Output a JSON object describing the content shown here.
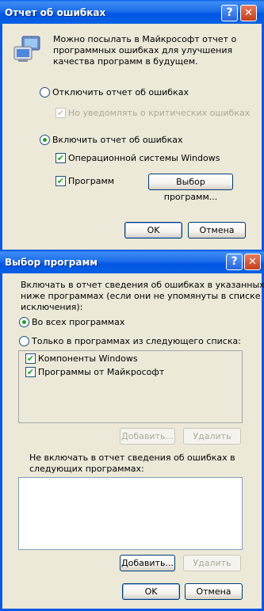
{
  "dialog1": {
    "title": "Отчет об ошибках",
    "description_lines": [
      "Можно посылать в Майкрософт отчет о",
      "программных ошибках для улучшения",
      "качества программ в будущем."
    ],
    "disable_option": "Отключить отчет об ошибках",
    "notify_critical": "Но уведомлять о критических ошибках",
    "enable_option": "Включить отчет об ошибках",
    "windows_os": "Операционной системы Windows",
    "programs": "Программ",
    "choose_programs_button": "Выбор программ...",
    "ok_button": "OK",
    "cancel_button": "Отмена"
  },
  "dialog2": {
    "title": "Выбор программ",
    "include_lines": [
      "Включать в отчет сведения об ошибках в указанных",
      "ниже программах (если они не упомянуты в списке",
      "исключения):"
    ],
    "all_programs": "Во всех программах",
    "only_listed": "Только в программах из следующего списка:",
    "list_items": [
      "Компоненты Windows",
      "Программы от Майкрософт"
    ],
    "add_button": "Добавить...",
    "remove_button": "Удалить",
    "exclude_lines": [
      "Не включать в отчет сведения об ошибках в",
      "следующих программах:"
    ],
    "add_button2": "Добавить...",
    "remove_button2": "Удалить",
    "ok_button": "OK",
    "cancel_button": "Отмена"
  },
  "titlebar_buttons": {
    "help": "?",
    "close": "✕"
  }
}
